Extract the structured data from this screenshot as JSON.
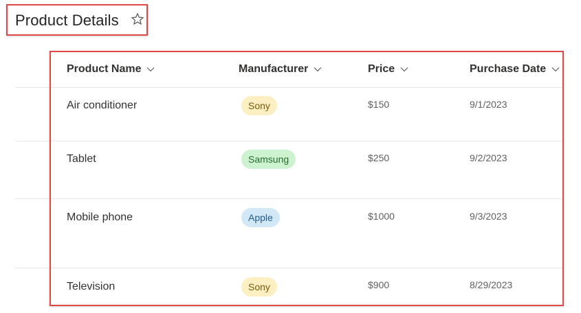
{
  "page": {
    "title": "Product Details",
    "star_icon": "star-outline-icon"
  },
  "table": {
    "columns": [
      {
        "label": "Product Name",
        "icon": "chevron-down-icon"
      },
      {
        "label": "Manufacturer",
        "icon": "chevron-down-icon"
      },
      {
        "label": "Price",
        "icon": "chevron-down-icon"
      },
      {
        "label": "Purchase Date",
        "icon": "chevron-down-icon"
      }
    ],
    "rows": [
      {
        "product": "Air conditioner",
        "manufacturer": "Sony",
        "price": "$150",
        "date": "9/1/2023"
      },
      {
        "product": "Tablet",
        "manufacturer": "Samsung",
        "price": "$250",
        "date": "9/2/2023"
      },
      {
        "product": "Mobile phone",
        "manufacturer": "Apple",
        "price": "$1000",
        "date": "9/3/2023"
      },
      {
        "product": "Television",
        "manufacturer": "Sony",
        "price": "$900",
        "date": "8/29/2023"
      }
    ]
  },
  "colors": {
    "annotation_border": "#e04848",
    "sony_pill": "#fcefc1",
    "samsung_pill": "#ccf2cf",
    "apple_pill": "#d2e8f7"
  }
}
